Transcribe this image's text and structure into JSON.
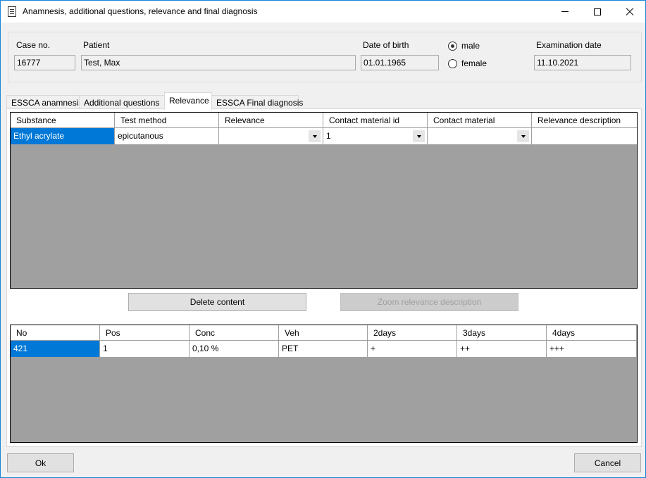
{
  "window": {
    "title": "Anamnesis, additional questions, relevance and final diagnosis"
  },
  "header": {
    "case_no_label": "Case no.",
    "case_no": "16777",
    "patient_label": "Patient",
    "patient": "Test, Max",
    "dob_label": "Date of birth",
    "dob": "01.01.1965",
    "sex_options": [
      {
        "label": "male",
        "checked": true
      },
      {
        "label": "female",
        "checked": false
      }
    ],
    "exam_date_label": "Examination date",
    "exam_date": "11.10.2021"
  },
  "tabs": [
    {
      "label": "ESSCA anamnesis",
      "active": false
    },
    {
      "label": "Additional questions",
      "active": false
    },
    {
      "label": "Relevance",
      "active": true
    },
    {
      "label": "ESSCA Final diagnosis",
      "active": false
    }
  ],
  "relevance_grid": {
    "columns": [
      "Substance",
      "Test method",
      "Relevance",
      "Contact material id",
      "Contact material",
      "Relevance description"
    ],
    "rows": [
      [
        "Ethyl acrylate",
        "epicutanous",
        "",
        "1",
        "",
        ""
      ]
    ]
  },
  "buttons": {
    "delete_content": "Delete content",
    "zoom_relevance": "Zoom relevance description",
    "ok": "Ok",
    "cancel": "Cancel"
  },
  "test_grid": {
    "columns": [
      "No",
      "Pos",
      "Conc",
      "Veh",
      "2days",
      "3days",
      "4days"
    ],
    "rows": [
      [
        "421",
        "1",
        "0,10 %",
        "PET",
        "+",
        "++",
        "+++"
      ]
    ]
  },
  "colors": {
    "selection": "#0078d7",
    "grid_background": "#a0a0a0",
    "window_border": "#1883d7"
  }
}
